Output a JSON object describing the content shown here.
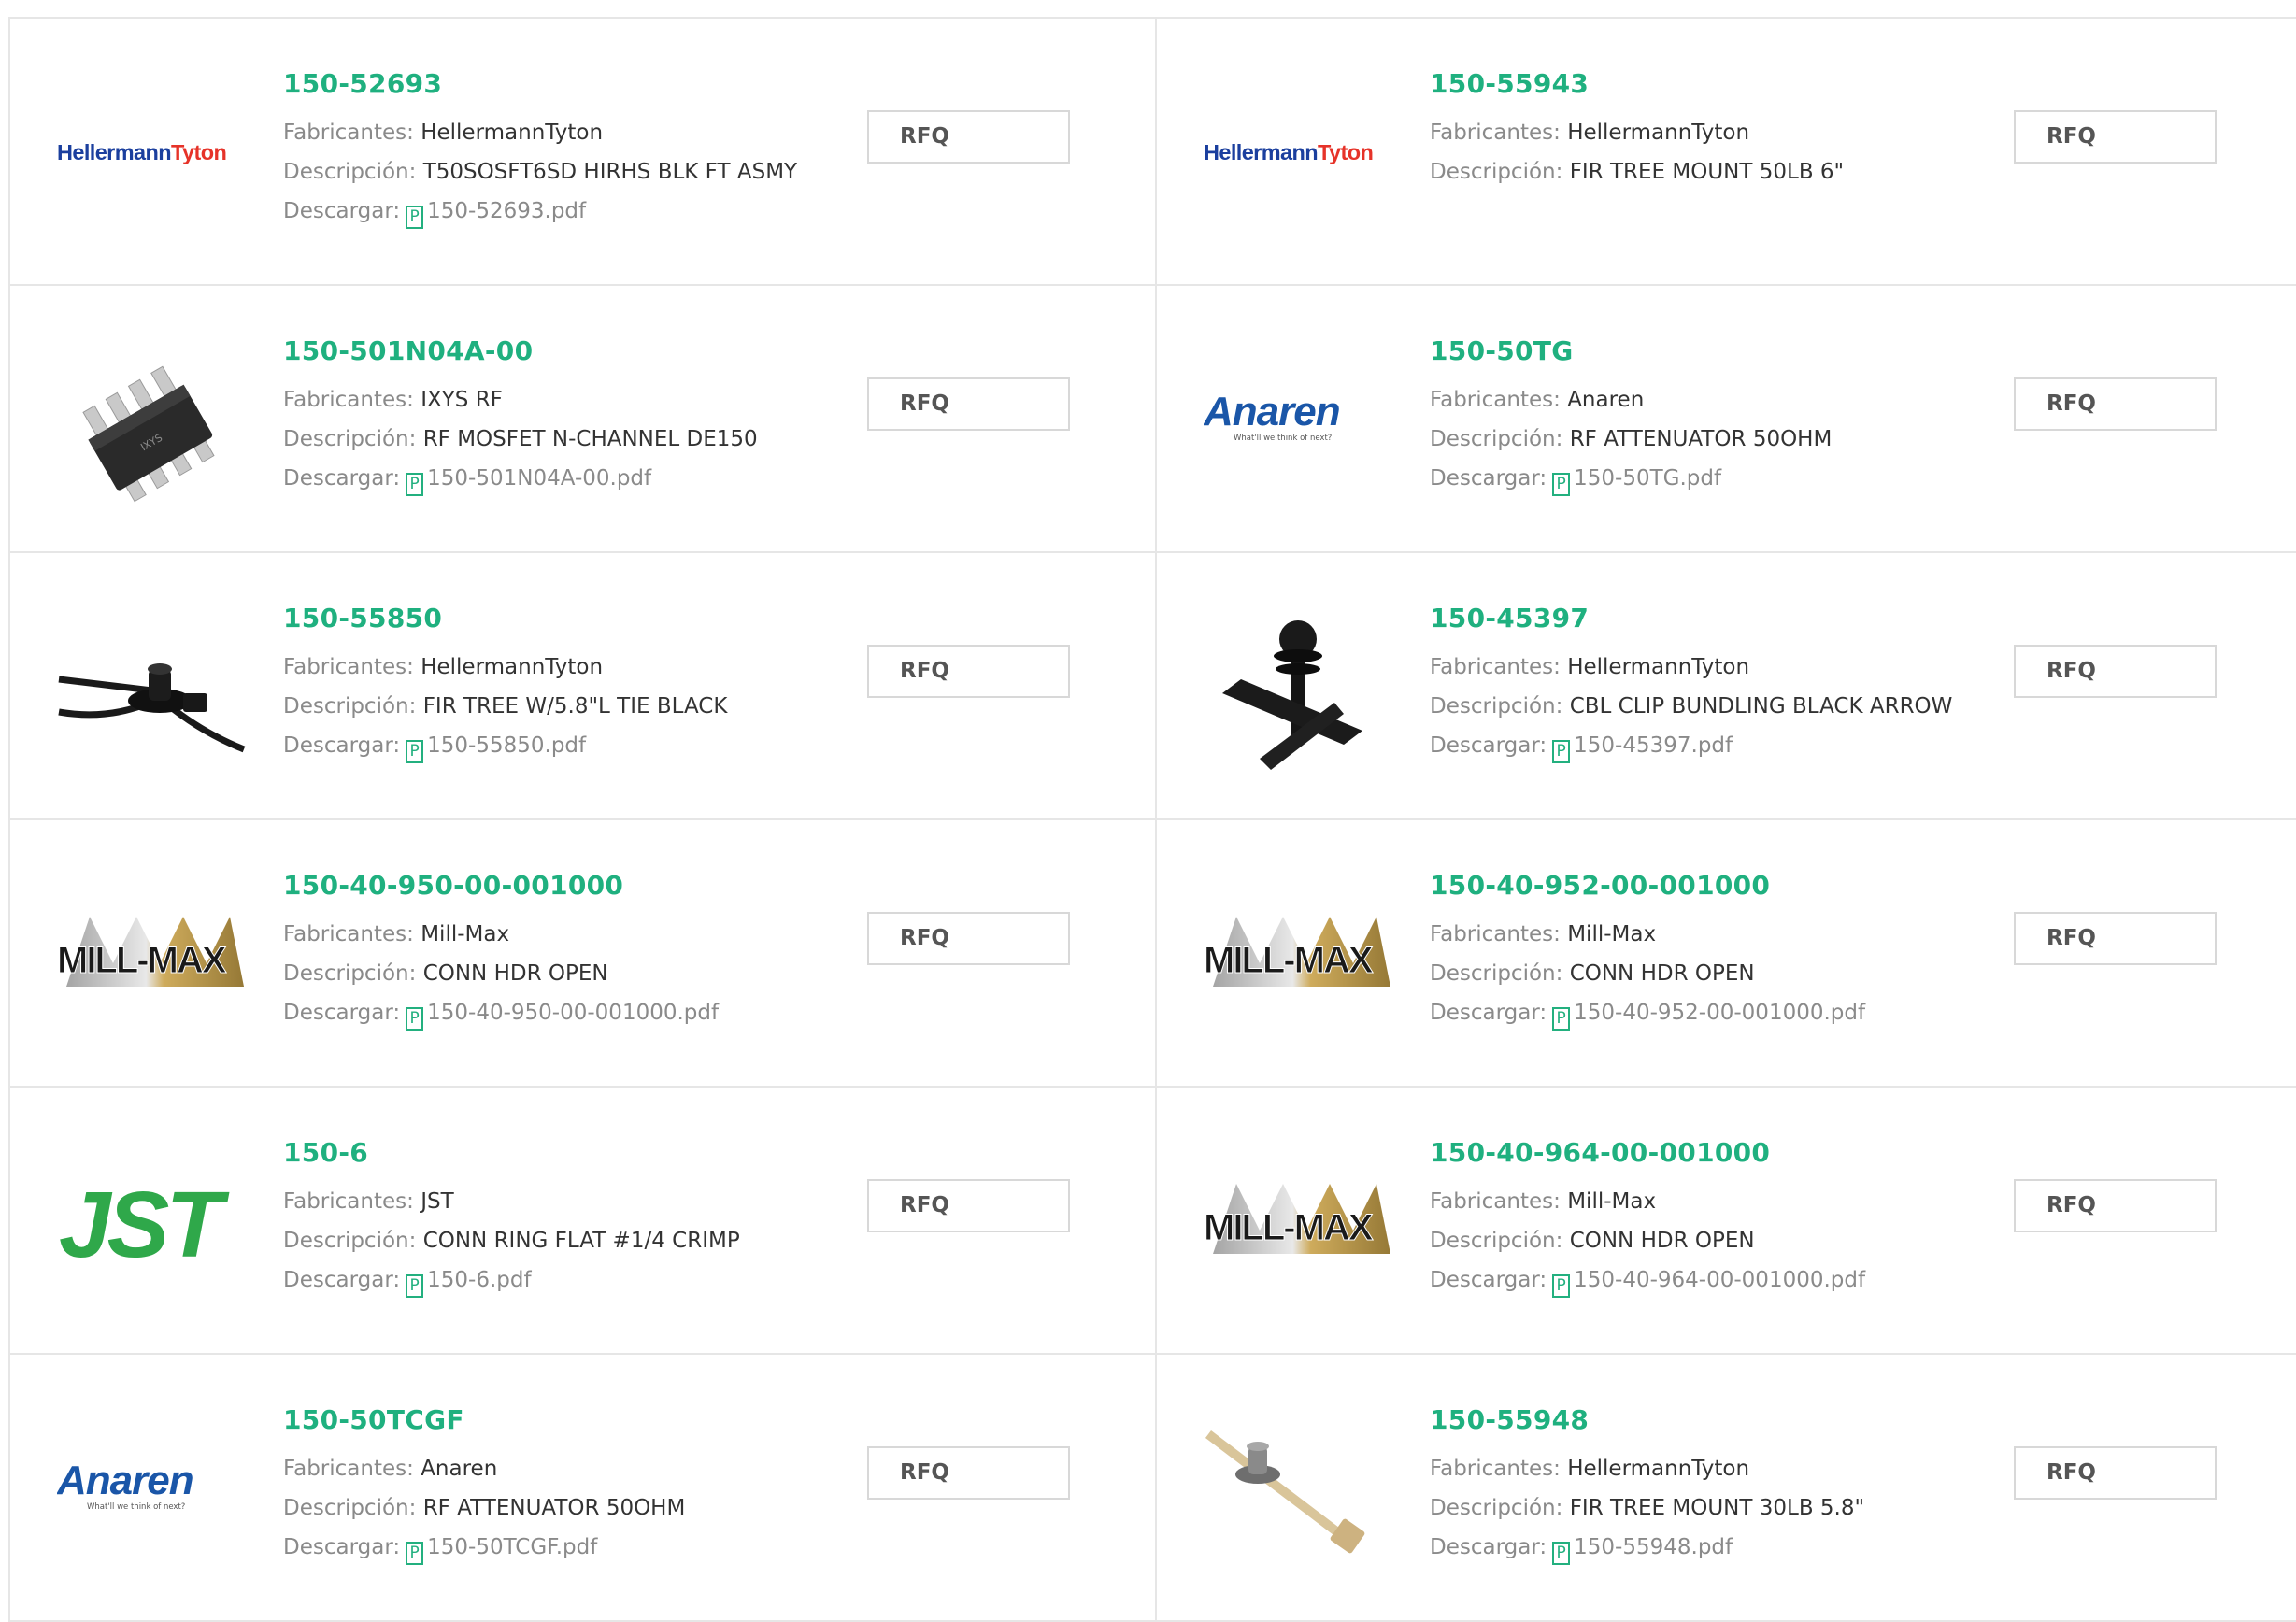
{
  "labels": {
    "manufacturer": "Fabricantes:",
    "description": "Descripción:",
    "download": "Descargar:",
    "rfq": "RFQ",
    "pdf_icon": "P"
  },
  "colors": {
    "part_link": "#1fb07f",
    "pdf_icon": "#23b07f",
    "border": "#e6e6e6"
  },
  "products": [
    {
      "part": "150-52693",
      "manufacturer": "HellermannTyton",
      "description": "T50SOSFT6SD HIRHS BLK FT ASMY",
      "pdf": "150-52693.pdf",
      "image": "hellermanntyton-logo"
    },
    {
      "part": "150-55943",
      "manufacturer": "HellermannTyton",
      "description": "FIR TREE MOUNT 50LB 6\"",
      "pdf": "150-55943.pdf",
      "image": "hellermanntyton-logo"
    },
    {
      "part": "150-501N04A-00",
      "manufacturer": "IXYS RF",
      "description": "RF MOSFET N-CHANNEL DE150",
      "pdf": "150-501N04A-00.pdf",
      "image": "mosfet-photo"
    },
    {
      "part": "150-50TG",
      "manufacturer": "Anaren",
      "description": "RF ATTENUATOR 50OHM",
      "pdf": "150-50TG.pdf",
      "image": "anaren-logo"
    },
    {
      "part": "150-55850",
      "manufacturer": "HellermannTyton",
      "description": "FIR TREE W/5.8\"L TIE BLACK",
      "pdf": "150-55850.pdf",
      "image": "fir-tree-tie-photo"
    },
    {
      "part": "150-45397",
      "manufacturer": "HellermannTyton",
      "description": "CBL CLIP BUNDLING BLACK ARROW",
      "pdf": "150-45397.pdf",
      "image": "cable-clip-photo"
    },
    {
      "part": "150-40-950-00-001000",
      "manufacturer": "Mill-Max",
      "description": "CONN HDR OPEN",
      "pdf": "150-40-950-00-001000.pdf",
      "image": "mill-max-logo"
    },
    {
      "part": "150-40-952-00-001000",
      "manufacturer": "Mill-Max",
      "description": "CONN HDR OPEN",
      "pdf": "150-40-952-00-001000.pdf",
      "image": "mill-max-logo"
    },
    {
      "part": "150-6",
      "manufacturer": "JST",
      "description": "CONN RING FLAT #1/4 CRIMP",
      "pdf": "150-6.pdf",
      "image": "jst-logo"
    },
    {
      "part": "150-40-964-00-001000",
      "manufacturer": "Mill-Max",
      "description": "CONN HDR OPEN",
      "pdf": "150-40-964-00-001000.pdf",
      "image": "mill-max-logo"
    },
    {
      "part": "150-50TCGF",
      "manufacturer": "Anaren",
      "description": "RF ATTENUATOR 50OHM",
      "pdf": "150-50TCGF.pdf",
      "image": "anaren-logo"
    },
    {
      "part": "150-55948",
      "manufacturer": "HellermannTyton",
      "description": "FIR TREE MOUNT 30LB 5.8\"",
      "pdf": "150-55948.pdf",
      "image": "fir-tree-mount-photo"
    }
  ],
  "logos": {
    "hellermanntyton": {
      "part1": "Hellermann",
      "part2": "Tyton"
    },
    "anaren": {
      "name": "Anaren",
      "tagline": "What'll we think of next?"
    },
    "mill_max": {
      "name": "MILL-MAX"
    },
    "jst": {
      "name": "JST"
    },
    "mosfet_marking": "IXYS"
  }
}
